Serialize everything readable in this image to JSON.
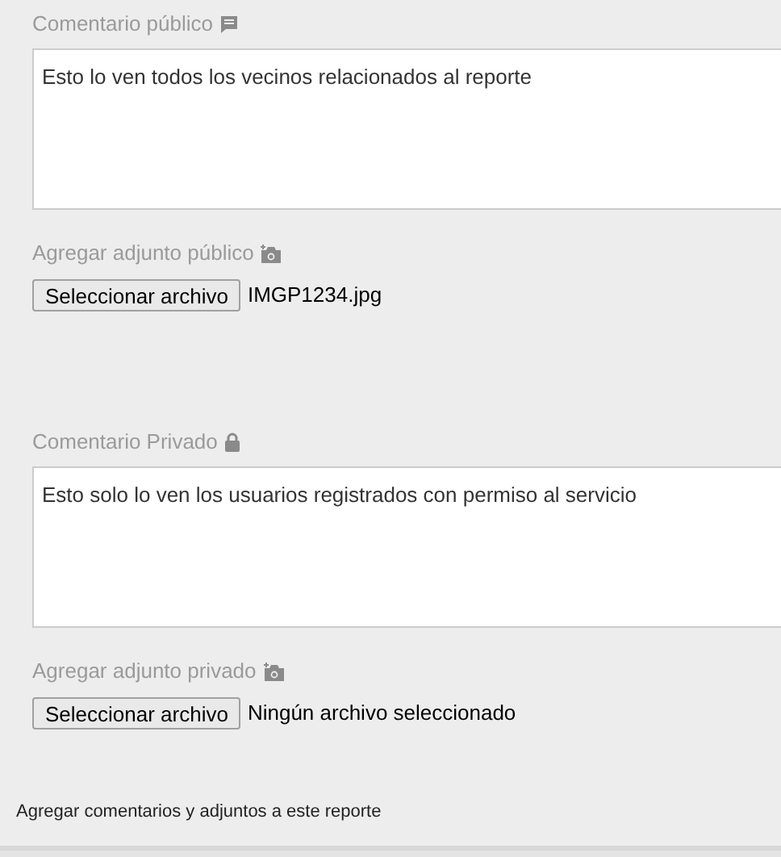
{
  "sections": [
    {
      "private": false,
      "comment_label": "Comentario público",
      "comment": "Esto lo ven todos los vecinos relacionados al reporte",
      "attachment_label": "Agregar adjunto público",
      "button": "Seleccionar archivo",
      "file_status": "IMGP1234.jpg"
    },
    {
      "private": true,
      "comment_label": "Comentario Privado",
      "comment": "Esto solo lo ven los usuarios registrados con permiso al servicio",
      "attachment_label": "Agregar adjunto privado",
      "button": "Seleccionar archivo",
      "file_status": "Ningún archivo seleccionado"
    }
  ],
  "footer": "Agregar comentarios y adjuntos a este reporte"
}
